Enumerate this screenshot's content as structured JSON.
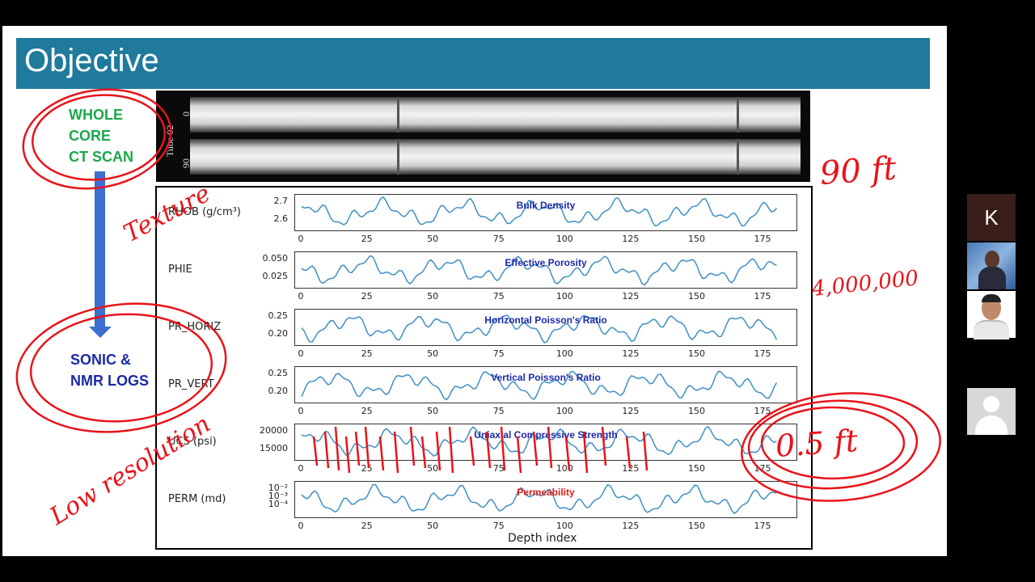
{
  "slide": {
    "title": "Objective",
    "left_labels": {
      "ct_line1": "WHOLE",
      "ct_line2": "CORE",
      "ct_line3": "CT SCAN",
      "logs_line1": "SONIC &",
      "logs_line2": "NMR LOGS"
    },
    "ct_image": {
      "tube_label": "Tube 02",
      "tube_number_1": "0",
      "tube_number_2": "90"
    },
    "tracks": [
      {
        "label": "RHOB (g/cm³)",
        "title": "Bulk Density",
        "title_color": "#1b2aa8",
        "yticks": [
          "2.7",
          "2.6"
        ]
      },
      {
        "label": "PHIE",
        "title": "Effective Porosity",
        "title_color": "#1b2aa8",
        "yticks": [
          "0.050",
          "0.025"
        ]
      },
      {
        "label": "PR_HORIZ",
        "title": "Horizontal Poisson's Ratio",
        "title_color": "#1b2aa8",
        "yticks": [
          "0.25",
          "0.20"
        ]
      },
      {
        "label": "PR_VERT",
        "title": "Vertical Poisson's Ratio",
        "title_color": "#1b2aa8",
        "yticks": [
          "0.25",
          "0.20"
        ]
      },
      {
        "label": "UCS (psi)",
        "title": "Uniaxial Compressive Strength",
        "title_color": "#1b2aa8",
        "yticks": [
          "20000",
          "15000"
        ]
      },
      {
        "label": "PERM (md)",
        "title": "Permeability",
        "title_color": "#e0201a",
        "yticks": [
          "10⁻²",
          "10⁻³",
          "10⁻⁴"
        ]
      }
    ],
    "xticks": [
      "0",
      "25",
      "50",
      "75",
      "100",
      "125",
      "150",
      "175"
    ],
    "xlabel": "Depth index"
  },
  "annotations": {
    "texture": "Texture",
    "low_resolution": "Low resolution",
    "feet_90": "90 ft",
    "count": "4,000,000",
    "half_foot": "0.5 ft"
  },
  "participants": {
    "tile_initial": "K"
  },
  "colors": {
    "title_bar": "#1f7a9c",
    "curve": "#3f8fc4",
    "ink": "#e8141a",
    "green_label": "#1aa84a",
    "blue_label": "#1b2aa8"
  }
}
